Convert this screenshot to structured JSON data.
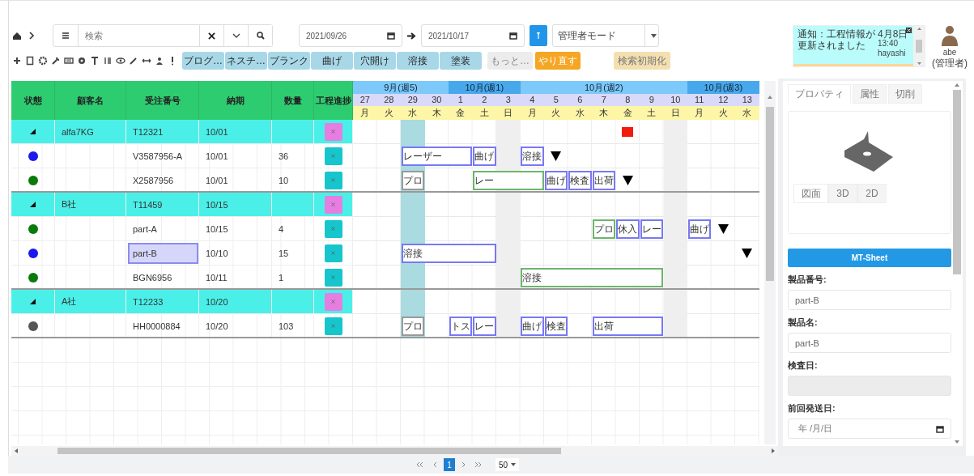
{
  "toolbar": {
    "search": {
      "placeholder": "検索"
    },
    "date_from": "2021/09/26",
    "date_to": "2021/10/17",
    "mode": "管理者モード",
    "buttons": [
      {
        "label": "プログ…",
        "kind": "process"
      },
      {
        "label": "ネスチ…",
        "kind": "process"
      },
      {
        "label": "ブランク",
        "kind": "process"
      },
      {
        "label": "曲げ",
        "kind": "process"
      },
      {
        "label": "穴開け",
        "kind": "process"
      },
      {
        "label": "溶接",
        "kind": "process"
      },
      {
        "label": "塗装",
        "kind": "process"
      },
      {
        "label": "もっと…",
        "kind": "more"
      },
      {
        "label": "やり直す",
        "kind": "redo"
      },
      {
        "label": "検索初期化",
        "kind": "reset"
      }
    ]
  },
  "notification": {
    "message": "通知：工程情報が更新されました",
    "date": "4月8日",
    "time": "13:40",
    "user": "hayashi"
  },
  "user": {
    "name": "abe",
    "role": "(管理者)"
  },
  "table": {
    "columns": [
      "状態",
      "顧客名",
      "受注番号",
      "納期",
      "数量",
      "工程進捗"
    ],
    "rows": [
      {
        "kind": "group",
        "expanded": true,
        "selected": false,
        "customer": "alfa7KG",
        "order": "T12321",
        "due": "10/01",
        "timeline": [
          {
            "kind": "empty"
          },
          {
            "kind": "empty"
          },
          {
            "kind": "empty"
          },
          {
            "kind": "empty"
          },
          {
            "kind": "empty"
          },
          {
            "kind": "empty"
          },
          {
            "kind": "empty"
          },
          {
            "kind": "empty"
          },
          {
            "kind": "empty"
          },
          {
            "kind": "empty"
          },
          {
            "kind": "empty"
          },
          {
            "kind": "alert"
          },
          {
            "kind": "empty"
          },
          {
            "kind": "empty"
          },
          {
            "kind": "empty"
          },
          {
            "kind": "empty"
          },
          {
            "kind": "empty"
          }
        ]
      },
      {
        "kind": "item",
        "color": "#1a1aee",
        "selected": false,
        "order": "V3587956-A",
        "due": "10/01",
        "qty": "36",
        "timeline": [
          {
            "kind": "empty"
          },
          {
            "kind": "empty"
          },
          {
            "kind": "bar",
            "label": "レーザー",
            "color": "#7878f5"
          },
          {
            "kind": "more"
          },
          {
            "kind": "more"
          },
          {
            "kind": "bar",
            "label": "曲げ",
            "color": "#7878f5"
          },
          {
            "kind": "empty"
          },
          {
            "kind": "bar",
            "label": "溶接",
            "color": "#7878f5"
          },
          {
            "kind": "deadline"
          },
          {
            "kind": "empty"
          },
          {
            "kind": "empty"
          },
          {
            "kind": "empty"
          },
          {
            "kind": "empty"
          },
          {
            "kind": "empty"
          },
          {
            "kind": "empty"
          },
          {
            "kind": "empty"
          },
          {
            "kind": "empty"
          }
        ]
      },
      {
        "kind": "item",
        "color": "#0a7a0a",
        "selected": false,
        "order": "X2587956",
        "due": "10/01",
        "qty": "10",
        "timeline": [
          {
            "kind": "empty"
          },
          {
            "kind": "empty"
          },
          {
            "kind": "bar",
            "label": "プロ",
            "color": "#9a9a9a"
          },
          {
            "kind": "empty"
          },
          {
            "kind": "empty"
          },
          {
            "kind": "bar",
            "label": "レー",
            "color": "#6db56d"
          },
          {
            "kind": "more"
          },
          {
            "kind": "more"
          },
          {
            "kind": "bar",
            "label": "曲げ",
            "color": "#7878f5"
          },
          {
            "kind": "bar",
            "label": "検査",
            "color": "#7878f5"
          },
          {
            "kind": "bar",
            "label": "出荷",
            "color": "#7878f5"
          },
          {
            "kind": "deadline"
          },
          {
            "kind": "empty"
          },
          {
            "kind": "empty"
          },
          {
            "kind": "empty"
          },
          {
            "kind": "empty"
          },
          {
            "kind": "empty"
          }
        ]
      },
      {
        "kind": "group",
        "expanded": true,
        "selected": false,
        "customer": "B社",
        "order": "T11459",
        "due": "10/15",
        "timeline": []
      },
      {
        "kind": "item",
        "color": "#0a7a0a",
        "selected": false,
        "order": "part-A",
        "due": "10/15",
        "qty": "4",
        "timeline": [
          {
            "kind": "empty"
          },
          {
            "kind": "empty"
          },
          {
            "kind": "empty"
          },
          {
            "kind": "empty"
          },
          {
            "kind": "empty"
          },
          {
            "kind": "empty"
          },
          {
            "kind": "empty"
          },
          {
            "kind": "empty"
          },
          {
            "kind": "empty"
          },
          {
            "kind": "empty"
          },
          {
            "kind": "bar",
            "label": "プロ",
            "color": "#6db56d"
          },
          {
            "kind": "bar",
            "label": "休入",
            "color": "#7878f5"
          },
          {
            "kind": "bar",
            "label": "レー",
            "color": "#7878f5"
          },
          {
            "kind": "empty"
          },
          {
            "kind": "bar",
            "label": "曲げ",
            "color": "#7878f5"
          },
          {
            "kind": "deadline"
          },
          {
            "kind": "empty"
          }
        ]
      },
      {
        "kind": "item",
        "color": "#1a1aee",
        "selected": true,
        "order": "part-B",
        "due": "10/10",
        "qty": "15",
        "timeline": [
          {
            "kind": "empty"
          },
          {
            "kind": "empty"
          },
          {
            "kind": "bar",
            "label": "溶接",
            "color": "#7878f5"
          },
          {
            "kind": "more"
          },
          {
            "kind": "more"
          },
          {
            "kind": "more"
          },
          {
            "kind": "empty"
          },
          {
            "kind": "empty"
          },
          {
            "kind": "empty"
          },
          {
            "kind": "empty"
          },
          {
            "kind": "empty"
          },
          {
            "kind": "empty"
          },
          {
            "kind": "empty"
          },
          {
            "kind": "empty"
          },
          {
            "kind": "empty"
          },
          {
            "kind": "empty"
          },
          {
            "kind": "deadline"
          }
        ]
      },
      {
        "kind": "item",
        "color": "#0a7a0a",
        "selected": false,
        "order": "BGN6956",
        "due": "10/11",
        "qty": "1",
        "timeline": [
          {
            "kind": "empty"
          },
          {
            "kind": "empty"
          },
          {
            "kind": "empty"
          },
          {
            "kind": "empty"
          },
          {
            "kind": "empty"
          },
          {
            "kind": "empty"
          },
          {
            "kind": "empty"
          },
          {
            "kind": "bar",
            "label": "溶接",
            "color": "#6db56d"
          },
          {
            "kind": "more"
          },
          {
            "kind": "more"
          },
          {
            "kind": "more"
          },
          {
            "kind": "more"
          },
          {
            "kind": "more"
          }
        ]
      },
      {
        "kind": "group",
        "expanded": true,
        "selected": false,
        "customer": "A社",
        "order": "T12233",
        "due": "10/20",
        "timeline": []
      },
      {
        "kind": "item",
        "color": "#555555",
        "selected": false,
        "order": "HH0000884",
        "due": "10/20",
        "qty": "103",
        "timeline": [
          {
            "kind": "empty"
          },
          {
            "kind": "empty"
          },
          {
            "kind": "bar",
            "label": "プロ",
            "color": "#9a9a9a"
          },
          {
            "kind": "empty"
          },
          {
            "kind": "bar",
            "label": "トス",
            "color": "#7878f5"
          },
          {
            "kind": "bar",
            "label": "レー",
            "color": "#7878f5"
          },
          {
            "kind": "empty"
          },
          {
            "kind": "bar",
            "label": "曲げ",
            "color": "#7878f5"
          },
          {
            "kind": "bar",
            "label": "検査",
            "color": "#7878f5"
          },
          {
            "kind": "empty"
          },
          {
            "kind": "bar",
            "label": "出荷",
            "color": "#7878f5"
          },
          {
            "kind": "more"
          },
          {
            "kind": "more"
          }
        ]
      }
    ]
  },
  "gantt": {
    "months": [
      {
        "label": "9月(週5)",
        "days": [
          {
            "day": "27",
            "weekday": "月",
            "weekend": false,
            "today": false
          },
          {
            "day": "28",
            "weekday": "火",
            "weekend": false,
            "today": false
          },
          {
            "day": "29",
            "weekday": "水",
            "weekend": false,
            "today": true
          },
          {
            "day": "30",
            "weekday": "木",
            "weekend": false,
            "today": false
          }
        ]
      },
      {
        "label": "10月(週1)",
        "days": [
          {
            "day": "1",
            "weekday": "金",
            "weekend": false,
            "today": false
          },
          {
            "day": "2",
            "weekday": "土",
            "weekend": false,
            "today": false
          },
          {
            "day": "3",
            "weekday": "日",
            "weekend": true,
            "today": false
          }
        ]
      },
      {
        "label": "10月(週2)",
        "days": [
          {
            "day": "4",
            "weekday": "月",
            "weekend": false,
            "today": false
          },
          {
            "day": "5",
            "weekday": "火",
            "weekend": false,
            "today": false
          },
          {
            "day": "6",
            "weekday": "水",
            "weekend": false,
            "today": false
          },
          {
            "day": "7",
            "weekday": "木",
            "weekend": false,
            "today": false
          },
          {
            "day": "8",
            "weekday": "金",
            "weekend": false,
            "today": false
          },
          {
            "day": "9",
            "weekday": "土",
            "weekend": false,
            "today": false
          },
          {
            "day": "10",
            "weekday": "日",
            "weekend": true,
            "today": false
          }
        ]
      },
      {
        "label": "10月(週3)",
        "days": [
          {
            "day": "11",
            "weekday": "月",
            "weekend": false,
            "today": false
          },
          {
            "day": "12",
            "weekday": "火",
            "weekend": false,
            "today": false
          },
          {
            "day": "13",
            "weekday": "水",
            "weekend": false,
            "today": false
          }
        ]
      }
    ]
  },
  "panel": {
    "tabs": [
      {
        "label": "プロパティ",
        "selected": true
      },
      {
        "label": "属性",
        "selected": false
      },
      {
        "label": "切削",
        "selected": false
      }
    ],
    "view_tabs": [
      {
        "label": "図面",
        "selected": true
      },
      {
        "label": "3D",
        "selected": false
      },
      {
        "label": "2D",
        "selected": false
      }
    ],
    "action": "MT-Sheet",
    "fields": [
      {
        "label": "製品番号:",
        "value": "part-B",
        "kind": "text",
        "disabled": false
      },
      {
        "label": "製品名:",
        "value": "part-B",
        "kind": "text",
        "disabled": false
      },
      {
        "label": "検査日:",
        "kind": "text",
        "disabled": true
      },
      {
        "label": "前回発送日:",
        "placeholder": "年 /月/日",
        "kind": "date",
        "disabled": false
      }
    ]
  },
  "pager": {
    "pages": [
      {
        "label": "1",
        "selected": true
      }
    ],
    "page_size": "50"
  }
}
